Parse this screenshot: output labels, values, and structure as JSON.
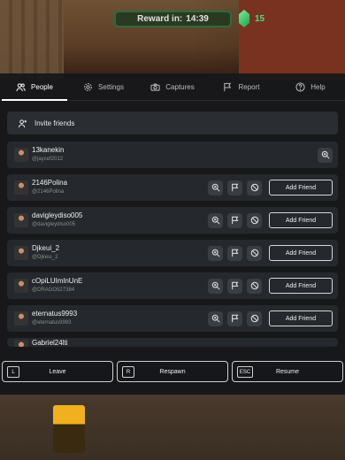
{
  "reward": {
    "label": "Reward in:",
    "time": "14:39"
  },
  "gems": {
    "count": "15",
    "color": "#3ec46a"
  },
  "tabs": [
    {
      "label": "People",
      "icon": "people-icon",
      "active": true
    },
    {
      "label": "Settings",
      "icon": "gear-icon",
      "active": false
    },
    {
      "label": "Captures",
      "icon": "camera-icon",
      "active": false
    },
    {
      "label": "Report",
      "icon": "flag-icon",
      "active": false
    },
    {
      "label": "Help",
      "icon": "help-icon",
      "active": false
    }
  ],
  "invite": {
    "label": "Invite friends"
  },
  "players": [
    {
      "display": "13kanekin",
      "handle": "@jaycef2012"
    },
    {
      "display": "2146Polina",
      "handle": "@2146Polina"
    },
    {
      "display": "davigleydiso005",
      "handle": "@davigleydiso005"
    },
    {
      "display": "Djkeui_2",
      "handle": "@Djkeui_2"
    },
    {
      "display": "cOpiLUImlnUnE",
      "handle": "@DRAGO527384"
    },
    {
      "display": "eternatus9993",
      "handle": "@eternatus9993"
    },
    {
      "display": "Gabriel24lti",
      "handle": ""
    }
  ],
  "add_friend_label": "Add Friend",
  "bottom": {
    "leave": {
      "key": "L",
      "label": "Leave"
    },
    "respawn": {
      "key": "R",
      "label": "Respawn"
    },
    "resume": {
      "key": "ESC",
      "label": "Resume"
    }
  }
}
